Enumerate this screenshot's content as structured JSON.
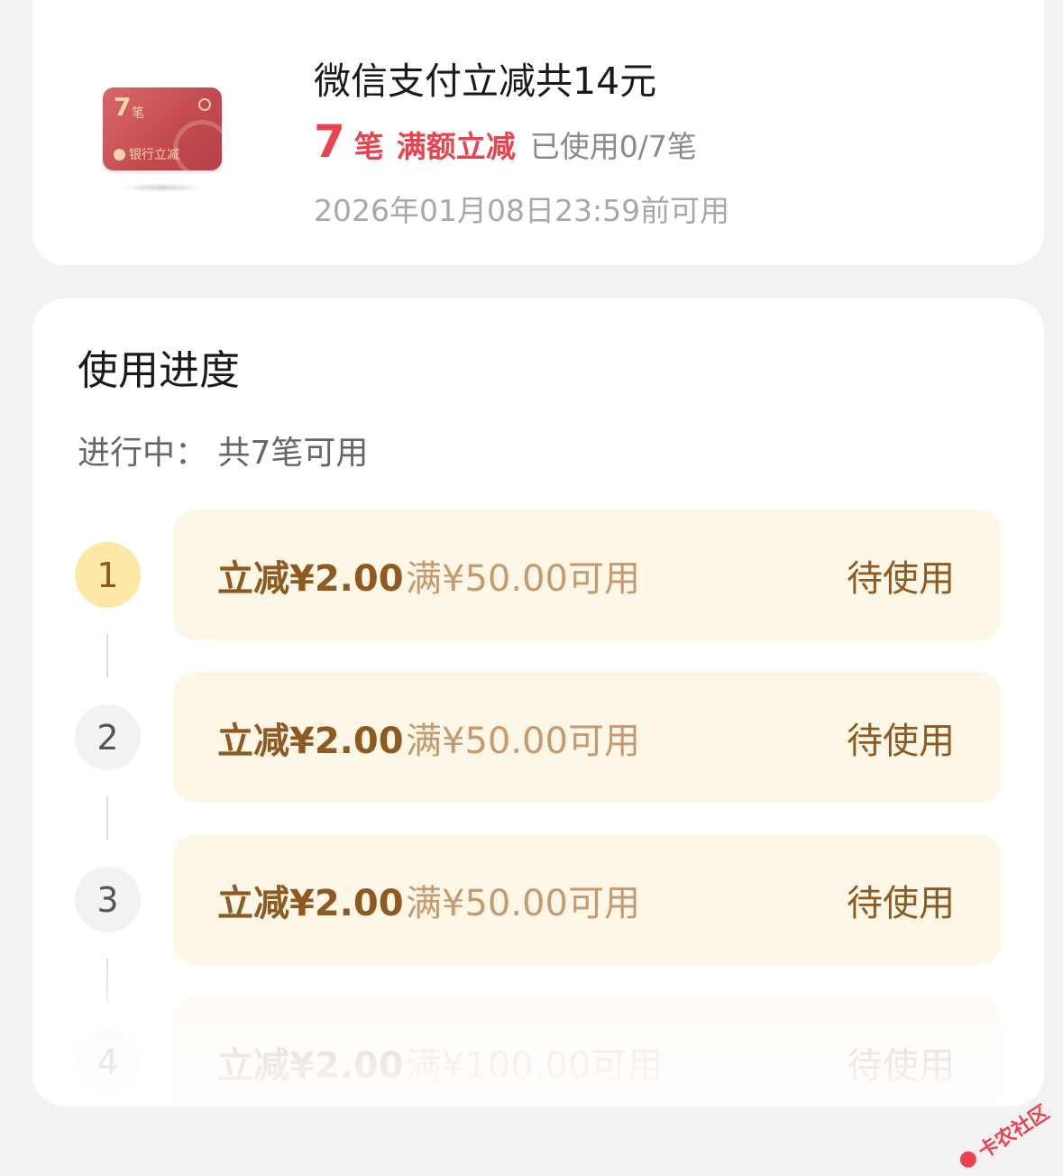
{
  "coupon_summary": {
    "title": "微信支付立减共14元",
    "count": "7",
    "count_unit": "笔",
    "type_tag": "满额立减",
    "used": "已使用0/7笔",
    "expiry": "2026年01月08日23:59前可用",
    "card_image": {
      "count": "7",
      "count_unit": "笔",
      "brand": "银行立减"
    }
  },
  "progress": {
    "title": "使用进度",
    "status": "进行中：  共7笔可用",
    "items": [
      {
        "index": "1",
        "amount": "立减¥2.00",
        "condition": "满¥50.00可用",
        "status": "待使用"
      },
      {
        "index": "2",
        "amount": "立减¥2.00",
        "condition": "满¥50.00可用",
        "status": "待使用"
      },
      {
        "index": "3",
        "amount": "立减¥2.00",
        "condition": "满¥50.00可用",
        "status": "待使用"
      },
      {
        "index": "4",
        "amount": "立减¥2.00",
        "condition": "满¥100.00可用",
        "status": "待使用"
      }
    ]
  },
  "watermark": "卡农社区",
  "colors": {
    "accent_red": "#e8434f",
    "row_bg": "#fdf7e8",
    "amount_brown": "#8f5a21",
    "condition_tan": "#c59a6e",
    "active_step": "#fce9a5"
  }
}
